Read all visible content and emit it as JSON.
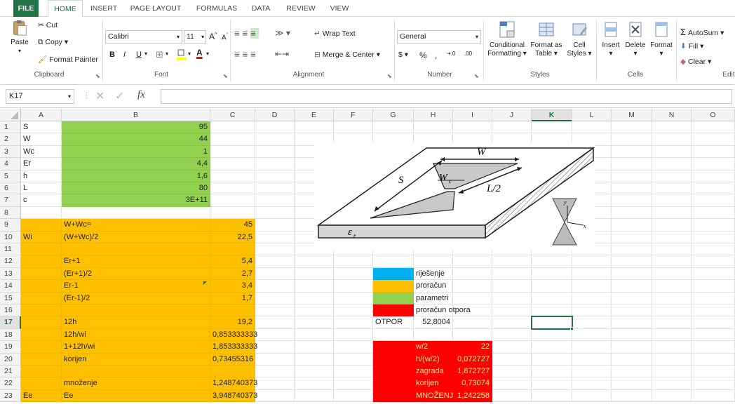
{
  "ribbon_tabs": [
    "FILE",
    "HOME",
    "INSERT",
    "PAGE LAYOUT",
    "FORMULAS",
    "DATA",
    "REVIEW",
    "VIEW"
  ],
  "clipboard": {
    "paste": "Paste",
    "cut": "Cut",
    "copy": "Copy",
    "format_painter": "Format Painter",
    "group": "Clipboard"
  },
  "font": {
    "name": "Calibri",
    "size": "11",
    "bold": "B",
    "italic": "I",
    "underline": "U",
    "grow": "A",
    "shrink": "A",
    "group": "Font"
  },
  "alignment": {
    "wrap": "Wrap Text",
    "merge": "Merge & Center",
    "group": "Alignment"
  },
  "number": {
    "format": "General",
    "currency": "$",
    "percent": "%",
    "comma": ",",
    "inc_dec": "+.0",
    "dec_dec": ".00",
    "group": "Number"
  },
  "styles": {
    "conditional": "Conditional",
    "conditional2": "Formatting",
    "format_table": "Format as",
    "format_table2": "Table",
    "cell_styles": "Cell",
    "cell_styles2": "Styles",
    "group": "Styles"
  },
  "cells": {
    "insert": "Insert",
    "delete": "Delete",
    "format": "Format",
    "group": "Cells"
  },
  "editing": {
    "autosum": "AutoSum",
    "fill": "Fill",
    "clear": "Clear",
    "group": "Edit"
  },
  "formula_bar": {
    "name_box": "K17",
    "fx": "fx",
    "value": ""
  },
  "columns": [
    "A",
    "B",
    "C",
    "D",
    "E",
    "F",
    "G",
    "H",
    "I",
    "J",
    "K",
    "L",
    "M",
    "N",
    "O"
  ],
  "rows": [
    "1",
    "2",
    "3",
    "4",
    "5",
    "6",
    "7",
    "8",
    "9",
    "10",
    "11",
    "12",
    "13",
    "14",
    "15",
    "16",
    "17",
    "18",
    "19",
    "20",
    "21",
    "22",
    "23"
  ],
  "colors": {
    "green": "#92d050",
    "orange": "#ffc000",
    "red": "#ff0000",
    "blue": "#00b0f0",
    "excel_green": "#217346"
  },
  "cells_data": {
    "A1": "S",
    "B1": "95",
    "A2": "W",
    "B2": "44",
    "A3": "Wc",
    "B3": "1",
    "A4": "Er",
    "B4": "4,4",
    "A5": "h",
    "B5": "1,6",
    "A6": "L",
    "B6": "80",
    "A7": "c",
    "B7": "3E+11",
    "B9": "W+Wc=",
    "C9": "45",
    "A10": "Wi",
    "B10": "(W+Wc)/2",
    "C10": "22,5",
    "B12": "Er+1",
    "C12": "5,4",
    "B13": "(Er+1)/2",
    "C13": "2,7",
    "B14": "Er-1",
    "C14": "3,4",
    "B15": "(Er-1)/2",
    "C15": "1,7",
    "B17": "12h",
    "C17": "19,2",
    "B18": "12h/wi",
    "C18": "0,853333333",
    "B19": "1+12h/wi",
    "C19": "1,853333333",
    "B20": "korijen",
    "C20": "0,73455316",
    "B22": "množenje",
    "C22": "1,248740373",
    "A23": "Ee",
    "B23": "Ee",
    "C23": "3,948740373",
    "H13": "riješenje",
    "H14": "proračun",
    "H15": "parametri",
    "H16": "proračun otpora",
    "G17": "OTPOR",
    "H17": "52,8004",
    "H19": "w/2",
    "I19": "22",
    "H20": "h/(w/2)",
    "I20": "0,072727",
    "H21": "zagrada",
    "I21": "1,872727",
    "H22": "korijen",
    "I22": "0,73074",
    "H23": "MNOŽENJ",
    "I23": "1,242258"
  },
  "diagram": {
    "W": "W",
    "S": "S",
    "Wc": "W",
    "Wc_sub": "c",
    "L2": "L/2",
    "er": "ε",
    "er_sub": "r",
    "y": "y",
    "x": "x"
  }
}
